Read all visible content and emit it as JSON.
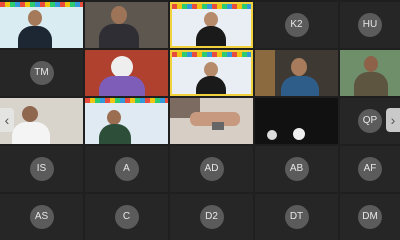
{
  "tiles": {
    "k2": "K2",
    "hu": "HU",
    "tm": "TM",
    "qp": "QP",
    "is": "IS",
    "a": "A",
    "ad": "AD",
    "ab": "AB",
    "af": "AF",
    "as": "AS",
    "c": "C",
    "d2": "D2",
    "dt": "DT",
    "dm": "DM"
  },
  "nav": {
    "prev_icon": "chevron-left-icon",
    "next_icon": "chevron-right-icon"
  },
  "colors": {
    "active_speaker": "#f2d23c",
    "tile_bg": "#262626",
    "avatar_bg": "#5b5b5b"
  }
}
